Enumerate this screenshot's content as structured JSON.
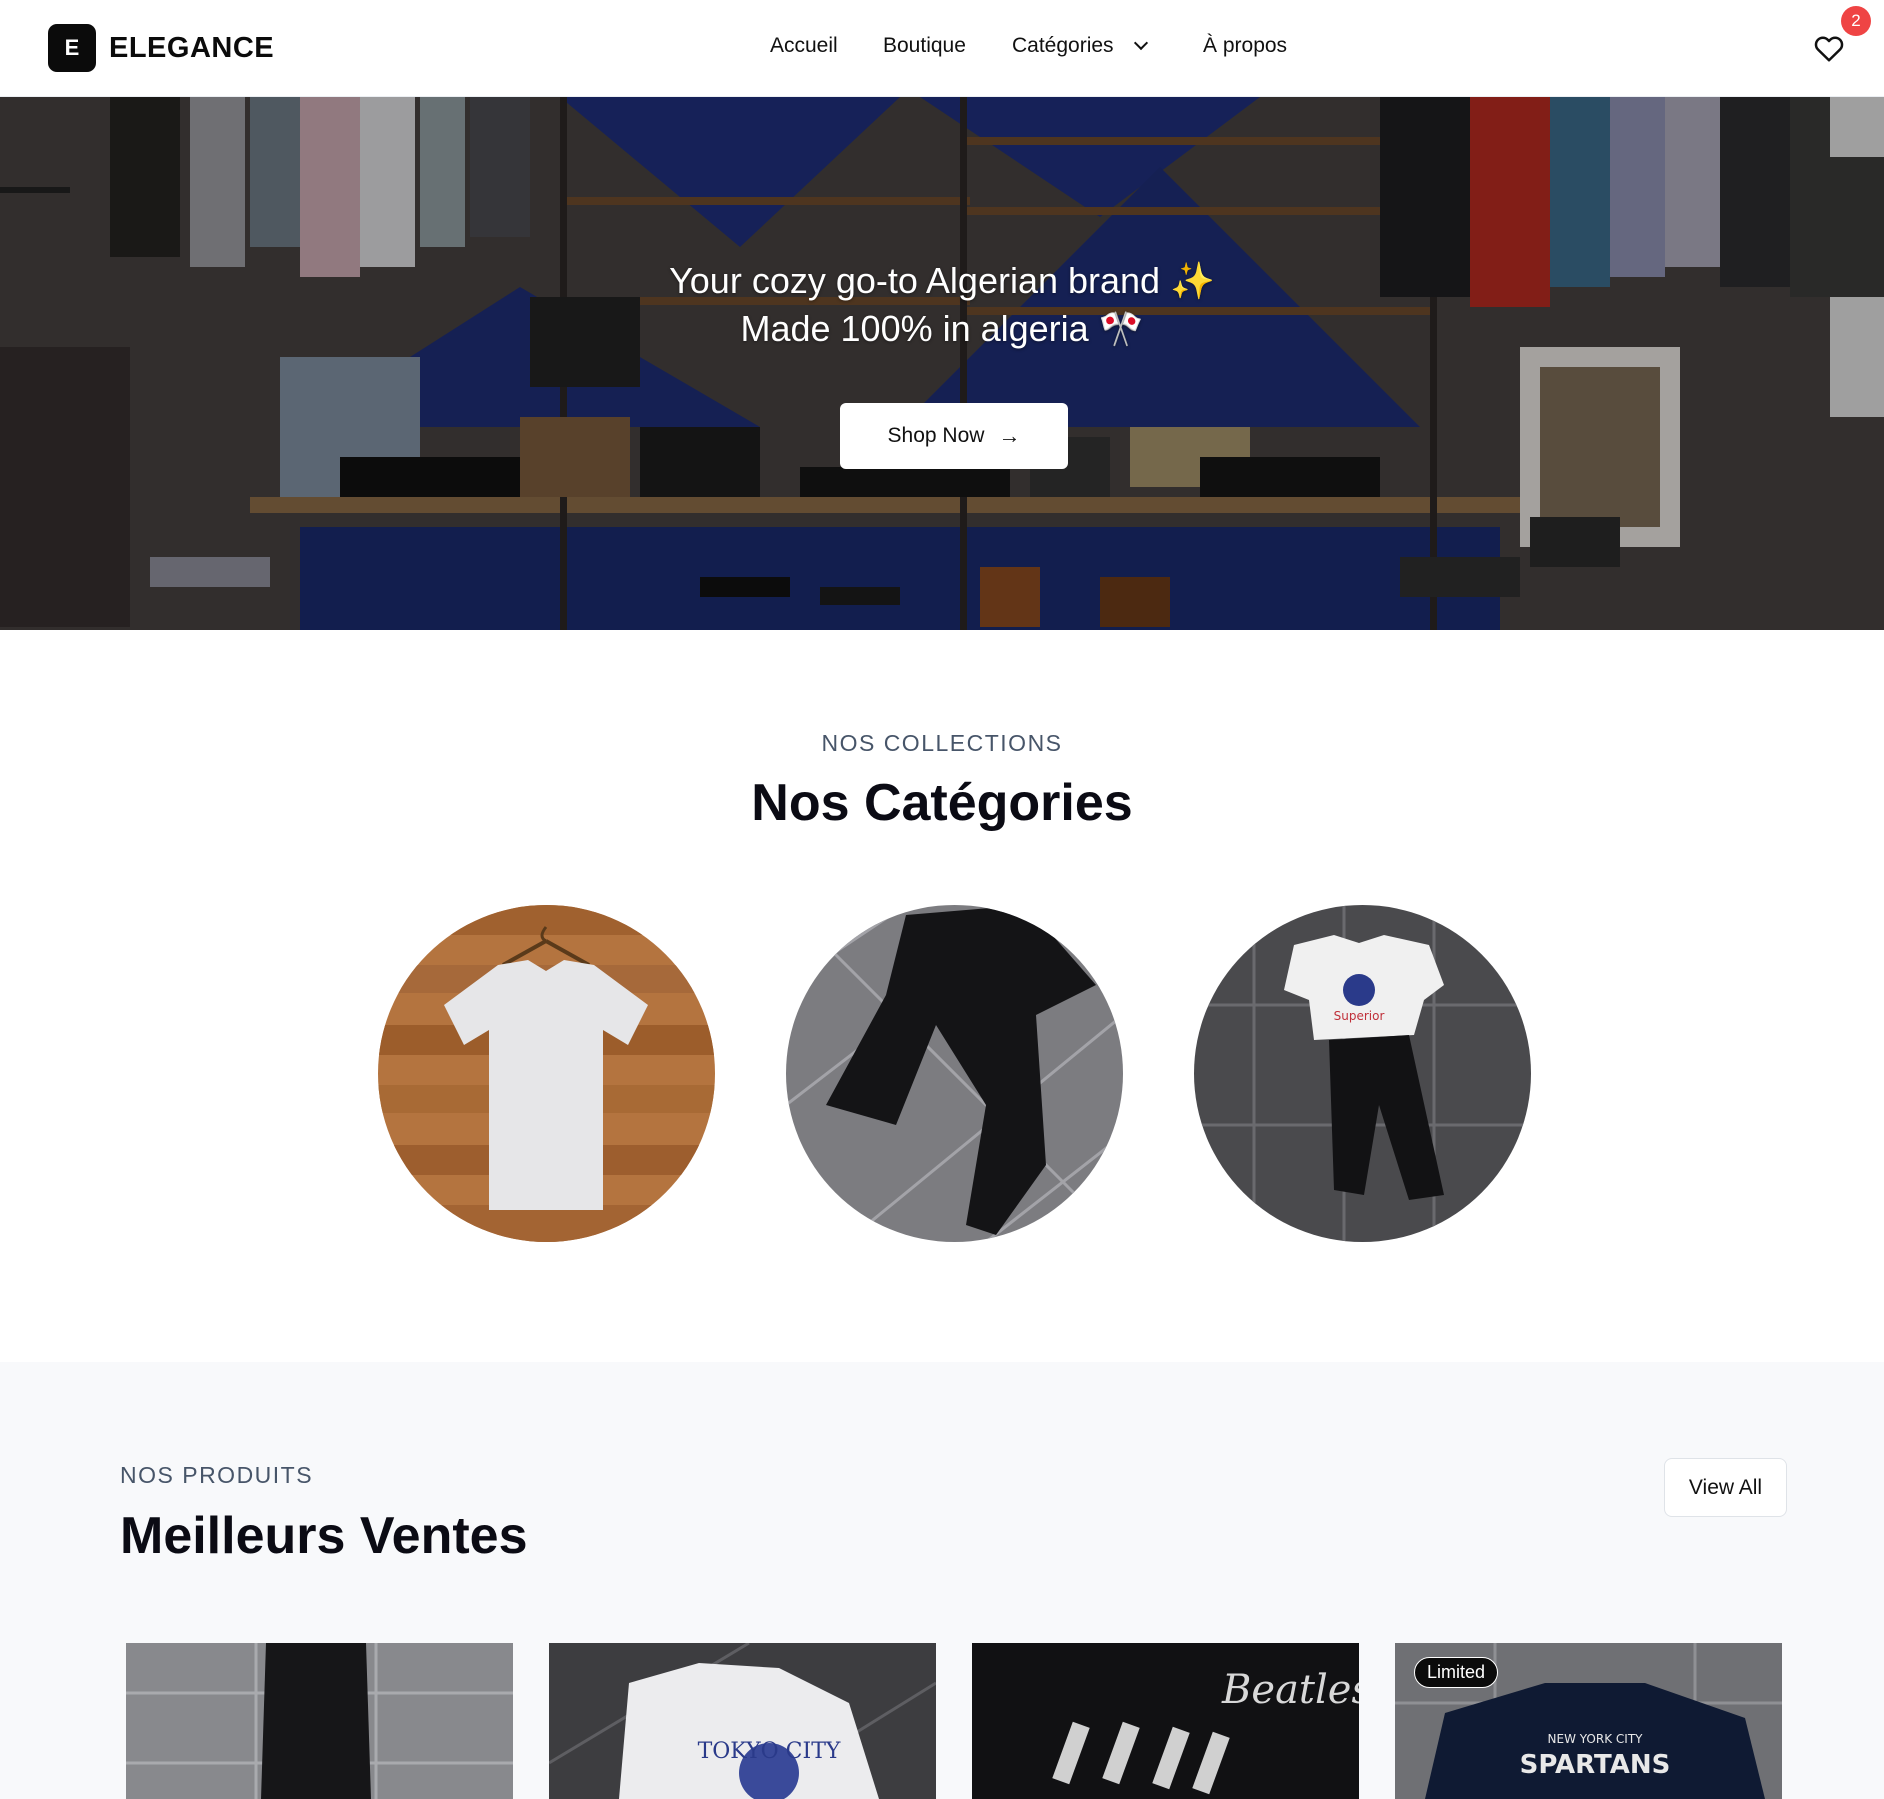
{
  "header": {
    "logo_letter": "E",
    "brand": "ELEGANCE",
    "nav": {
      "home": "Accueil",
      "shop": "Boutique",
      "categories": "Catégories",
      "about": "À propos"
    },
    "wishlist_count": "2"
  },
  "hero": {
    "line1": "Your cozy go-to Algerian brand ✨",
    "line2": "Made 100% in algeria 🎌",
    "cta": "Shop Now"
  },
  "categories": {
    "kicker": "NOS COLLECTIONS",
    "title": "Nos Catégories"
  },
  "products": {
    "kicker": "NOS PRODUITS",
    "title": "Meilleurs Ventes",
    "view_all": "View All",
    "limited_badge": "Limited"
  },
  "colors": {
    "accent": "#0b0b0b",
    "badge": "#ef4444",
    "section_bg": "#f8f9fb"
  }
}
